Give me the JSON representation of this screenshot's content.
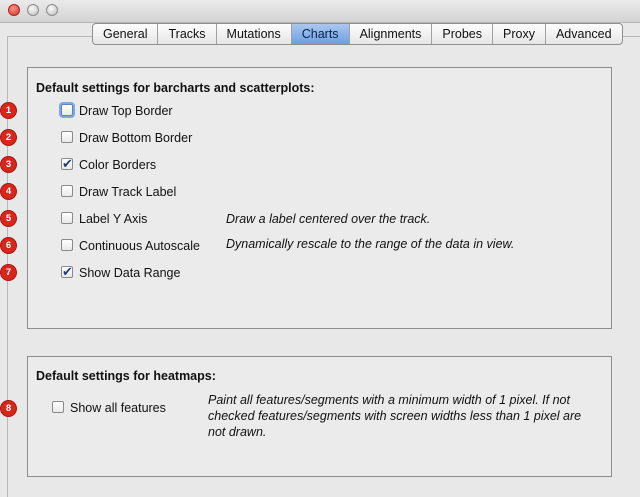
{
  "window": {
    "controls": [
      "close",
      "minimize",
      "maximize"
    ]
  },
  "tabs": [
    {
      "label": "General",
      "active": false
    },
    {
      "label": "Tracks",
      "active": false
    },
    {
      "label": "Mutations",
      "active": false
    },
    {
      "label": "Charts",
      "active": true
    },
    {
      "label": "Alignments",
      "active": false
    },
    {
      "label": "Probes",
      "active": false
    },
    {
      "label": "Proxy",
      "active": false
    },
    {
      "label": "Advanced",
      "active": false
    }
  ],
  "barcharts": {
    "title": "Default settings for barcharts and scatterplots:",
    "options": [
      {
        "label": "Draw Top Border",
        "checked": false,
        "badge": "1"
      },
      {
        "label": "Draw Bottom Border",
        "checked": false,
        "badge": "2"
      },
      {
        "label": "Color Borders",
        "checked": true,
        "badge": "3"
      },
      {
        "label": "Draw Track Label",
        "checked": false,
        "badge": "4"
      },
      {
        "label": "Label Y Axis",
        "checked": false,
        "badge": "5",
        "description": "Draw a label centered over the track."
      },
      {
        "label": "Continuous Autoscale",
        "checked": false,
        "badge": "6",
        "description": "Dynamically rescale to the range of the data in view."
      },
      {
        "label": "Show Data Range",
        "checked": true,
        "badge": "7"
      }
    ]
  },
  "heatmaps": {
    "title": "Default settings for heatmaps:",
    "option": {
      "label": "Show all features",
      "checked": false,
      "badge": "8"
    },
    "description": "Paint all features/segments with a minimum width of 1 pixel. If not checked features/segments with screen widths less than 1 pixel are not drawn."
  },
  "colors": {
    "badge": "#d8261d",
    "active_tab": "#6d9ee2"
  }
}
